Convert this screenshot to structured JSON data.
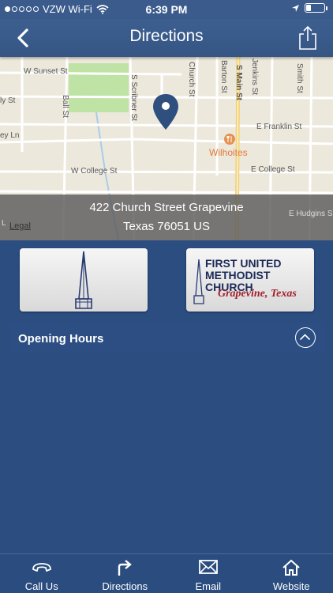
{
  "status_bar": {
    "carrier": "VZW Wi-Fi",
    "time": "6:39 PM"
  },
  "nav": {
    "title": "Directions",
    "back_icon": "chevron-left-icon",
    "share_icon": "share-icon"
  },
  "map": {
    "streets": {
      "w_sunset": "W Sunset St",
      "ball": "Ball St",
      "s_scribner": "S Scribner St",
      "church": "Church St",
      "barton": "Barton St",
      "s_main": "S Main St",
      "jenkins": "Jenkins St",
      "smith": "Smith St",
      "e_franklin": "E Franklin St",
      "w_college": "W College St",
      "e_college": "E College St",
      "e_hudgins": "E Hudgins S",
      "ely_partial": "ly St",
      "ey_ln": "ey Ln",
      "l_partial": "L"
    },
    "poi": "Wilhoites",
    "address_line1": "422 Church Street Grapevine",
    "address_line2": "Texas 76051 US",
    "legal": "Legal"
  },
  "logos": {
    "right_line1": "FIRST UNITED",
    "right_line2": "METHODIST CHURCH",
    "right_script": "Grapevine, Texas"
  },
  "hours": {
    "label": "Opening Hours",
    "toggle_icon": "chevron-up-circle-icon"
  },
  "tabs": [
    {
      "label": "Call Us",
      "icon": "phone-icon"
    },
    {
      "label": "Directions",
      "icon": "turn-right-arrow-icon"
    },
    {
      "label": "Email",
      "icon": "envelope-icon"
    },
    {
      "label": "Website",
      "icon": "home-icon"
    }
  ],
  "colors": {
    "background": "#2b4d80",
    "navbar": "#3a5b8c",
    "pin": "#2f4f7f",
    "poi": "#e07b3a"
  }
}
